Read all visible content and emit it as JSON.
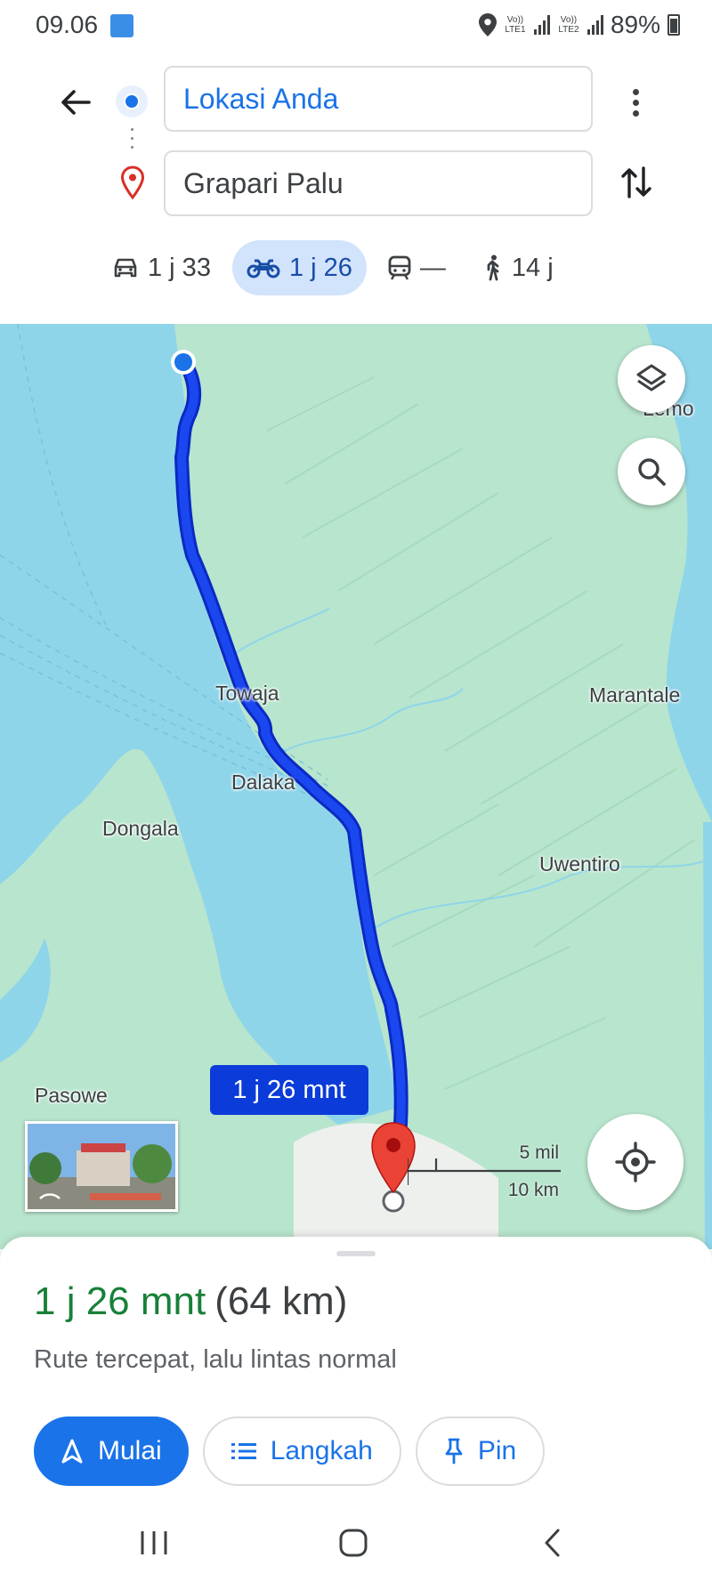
{
  "status_bar": {
    "time": "09.06",
    "sim1": "Vo)) LTE1",
    "sim2": "Vo)) LTE2",
    "battery": "89%"
  },
  "search": {
    "origin": "Lokasi Anda",
    "destination": "Grapari Palu"
  },
  "modes": [
    {
      "name": "car",
      "label": "1 j 33",
      "selected": false
    },
    {
      "name": "motorcycle",
      "label": "1 j 26",
      "selected": true
    },
    {
      "name": "transit",
      "label": "—",
      "selected": false
    },
    {
      "name": "walk",
      "label": "14 j",
      "selected": false
    }
  ],
  "map": {
    "labels": {
      "lemo": "Lemo",
      "towaja": "Towaja",
      "marantale": "Marantale",
      "dalaka": "Dalaka",
      "dongala": "Dongala",
      "uwentiro": "Uwentiro",
      "pasowe": "Pasowe"
    },
    "eta_chip": "1 j 26 mnt",
    "scale_imperial": "5 mil",
    "scale_metric": "10 km",
    "colors": {
      "water": "#8fd5ea",
      "land": "#b8e5cd",
      "route": "#0c35e6"
    }
  },
  "summary": {
    "duration": "1 j 26 mnt",
    "distance": "(64 km)",
    "description": "Rute tercepat, lalu lintas normal"
  },
  "actions": {
    "start": "Mulai",
    "steps": "Langkah",
    "pin": "Pin"
  }
}
